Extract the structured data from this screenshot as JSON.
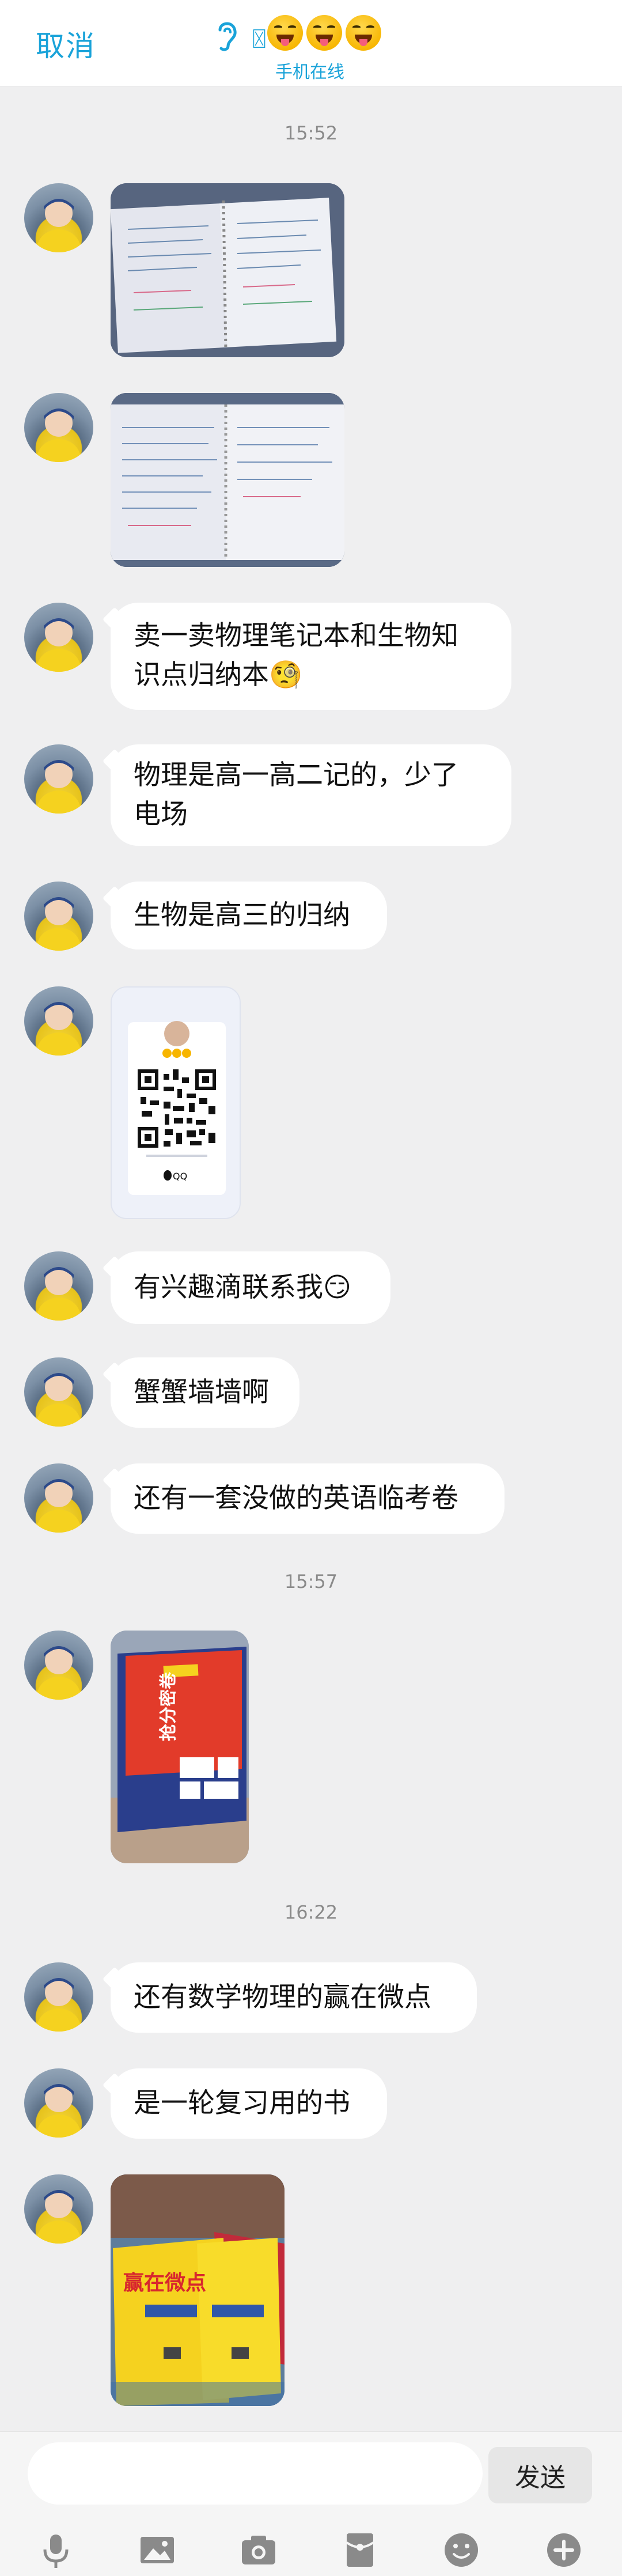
{
  "header": {
    "cancel_label": "取消",
    "title_glyph": "〿",
    "status": "手机在线"
  },
  "timestamps": [
    "15:52",
    "15:57",
    "16:22"
  ],
  "messages": [
    {
      "type": "image",
      "alt": "notebook-photo-1"
    },
    {
      "type": "image",
      "alt": "notebook-photo-2"
    },
    {
      "type": "text",
      "lines": [
        "卖一卖物理笔记本和生物知",
        "识点归纳本🧐"
      ]
    },
    {
      "type": "text",
      "lines": [
        "物理是高一高二记的，少了",
        "电场"
      ]
    },
    {
      "type": "text",
      "lines": [
        "生物是高三的归纳"
      ]
    },
    {
      "type": "qr",
      "caption": "QQ"
    },
    {
      "type": "text",
      "lines": [
        "有兴趣滴联系我😏"
      ]
    },
    {
      "type": "text",
      "lines": [
        "蟹蟹墙墙啊"
      ]
    },
    {
      "type": "text",
      "lines": [
        "还有一套没做的英语临考卷"
      ]
    },
    {
      "type": "image",
      "alt": "english-exam-book"
    },
    {
      "type": "text",
      "lines": [
        "还有数学物理的赢在微点"
      ]
    },
    {
      "type": "text",
      "lines": [
        "是一轮复习用的书"
      ]
    },
    {
      "type": "image",
      "alt": "review-books"
    }
  ],
  "book_text": {
    "exam_title": "抢分密卷",
    "review_title": "赢在微点"
  },
  "input": {
    "placeholder": "",
    "send_label": "发送"
  },
  "colors": {
    "accent": "#1aa3d9",
    "background": "#efeff0",
    "bubble": "#ffffff"
  },
  "toolbar_icons": [
    "mic-icon",
    "image-icon",
    "camera-icon",
    "red-packet-icon",
    "emoji-icon",
    "plus-icon"
  ]
}
